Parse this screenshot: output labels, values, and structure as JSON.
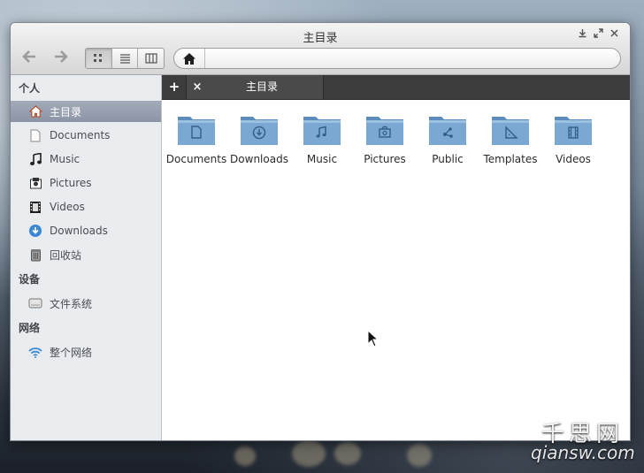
{
  "window": {
    "title": "主目录"
  },
  "toolbar": {
    "back_icon": "arrow-left-icon",
    "forward_icon": "arrow-right-icon",
    "views": [
      {
        "name": "icon-view",
        "active": true
      },
      {
        "name": "list-view",
        "active": false
      },
      {
        "name": "column-view",
        "active": false
      }
    ],
    "path_home_icon": "home-icon"
  },
  "sidebar": {
    "personal_header": "个人",
    "personal": [
      {
        "label": "主目录",
        "icon": "home-icon",
        "selected": true
      },
      {
        "label": "Documents",
        "icon": "document-icon"
      },
      {
        "label": "Music",
        "icon": "music-note-icon"
      },
      {
        "label": "Pictures",
        "icon": "picture-icon"
      },
      {
        "label": "Videos",
        "icon": "film-icon"
      },
      {
        "label": "Downloads",
        "icon": "download-icon"
      },
      {
        "label": "回收站",
        "icon": "trash-icon"
      }
    ],
    "devices_header": "设备",
    "devices": [
      {
        "label": "文件系统",
        "icon": "drive-icon"
      }
    ],
    "network_header": "网络",
    "network": [
      {
        "label": "整个网络",
        "icon": "wifi-icon"
      }
    ]
  },
  "tabs": {
    "add_label": "+",
    "close_label": "×",
    "active_tab_label": "主目录"
  },
  "files": [
    {
      "label": "Documents",
      "icon": "document-folder-icon"
    },
    {
      "label": "Downloads",
      "icon": "download-folder-icon"
    },
    {
      "label": "Music",
      "icon": "music-folder-icon"
    },
    {
      "label": "Pictures",
      "icon": "pictures-folder-icon"
    },
    {
      "label": "Public",
      "icon": "public-folder-icon"
    },
    {
      "label": "Templates",
      "icon": "templates-folder-icon"
    },
    {
      "label": "Videos",
      "icon": "videos-folder-icon"
    }
  ],
  "watermark": {
    "chinese": "千思网",
    "url": "qiansw.com"
  },
  "colors": {
    "folder": "#6f9ec9",
    "sidebar_selected": "#9aa2b2",
    "tabbar": "#3c3c3c"
  }
}
